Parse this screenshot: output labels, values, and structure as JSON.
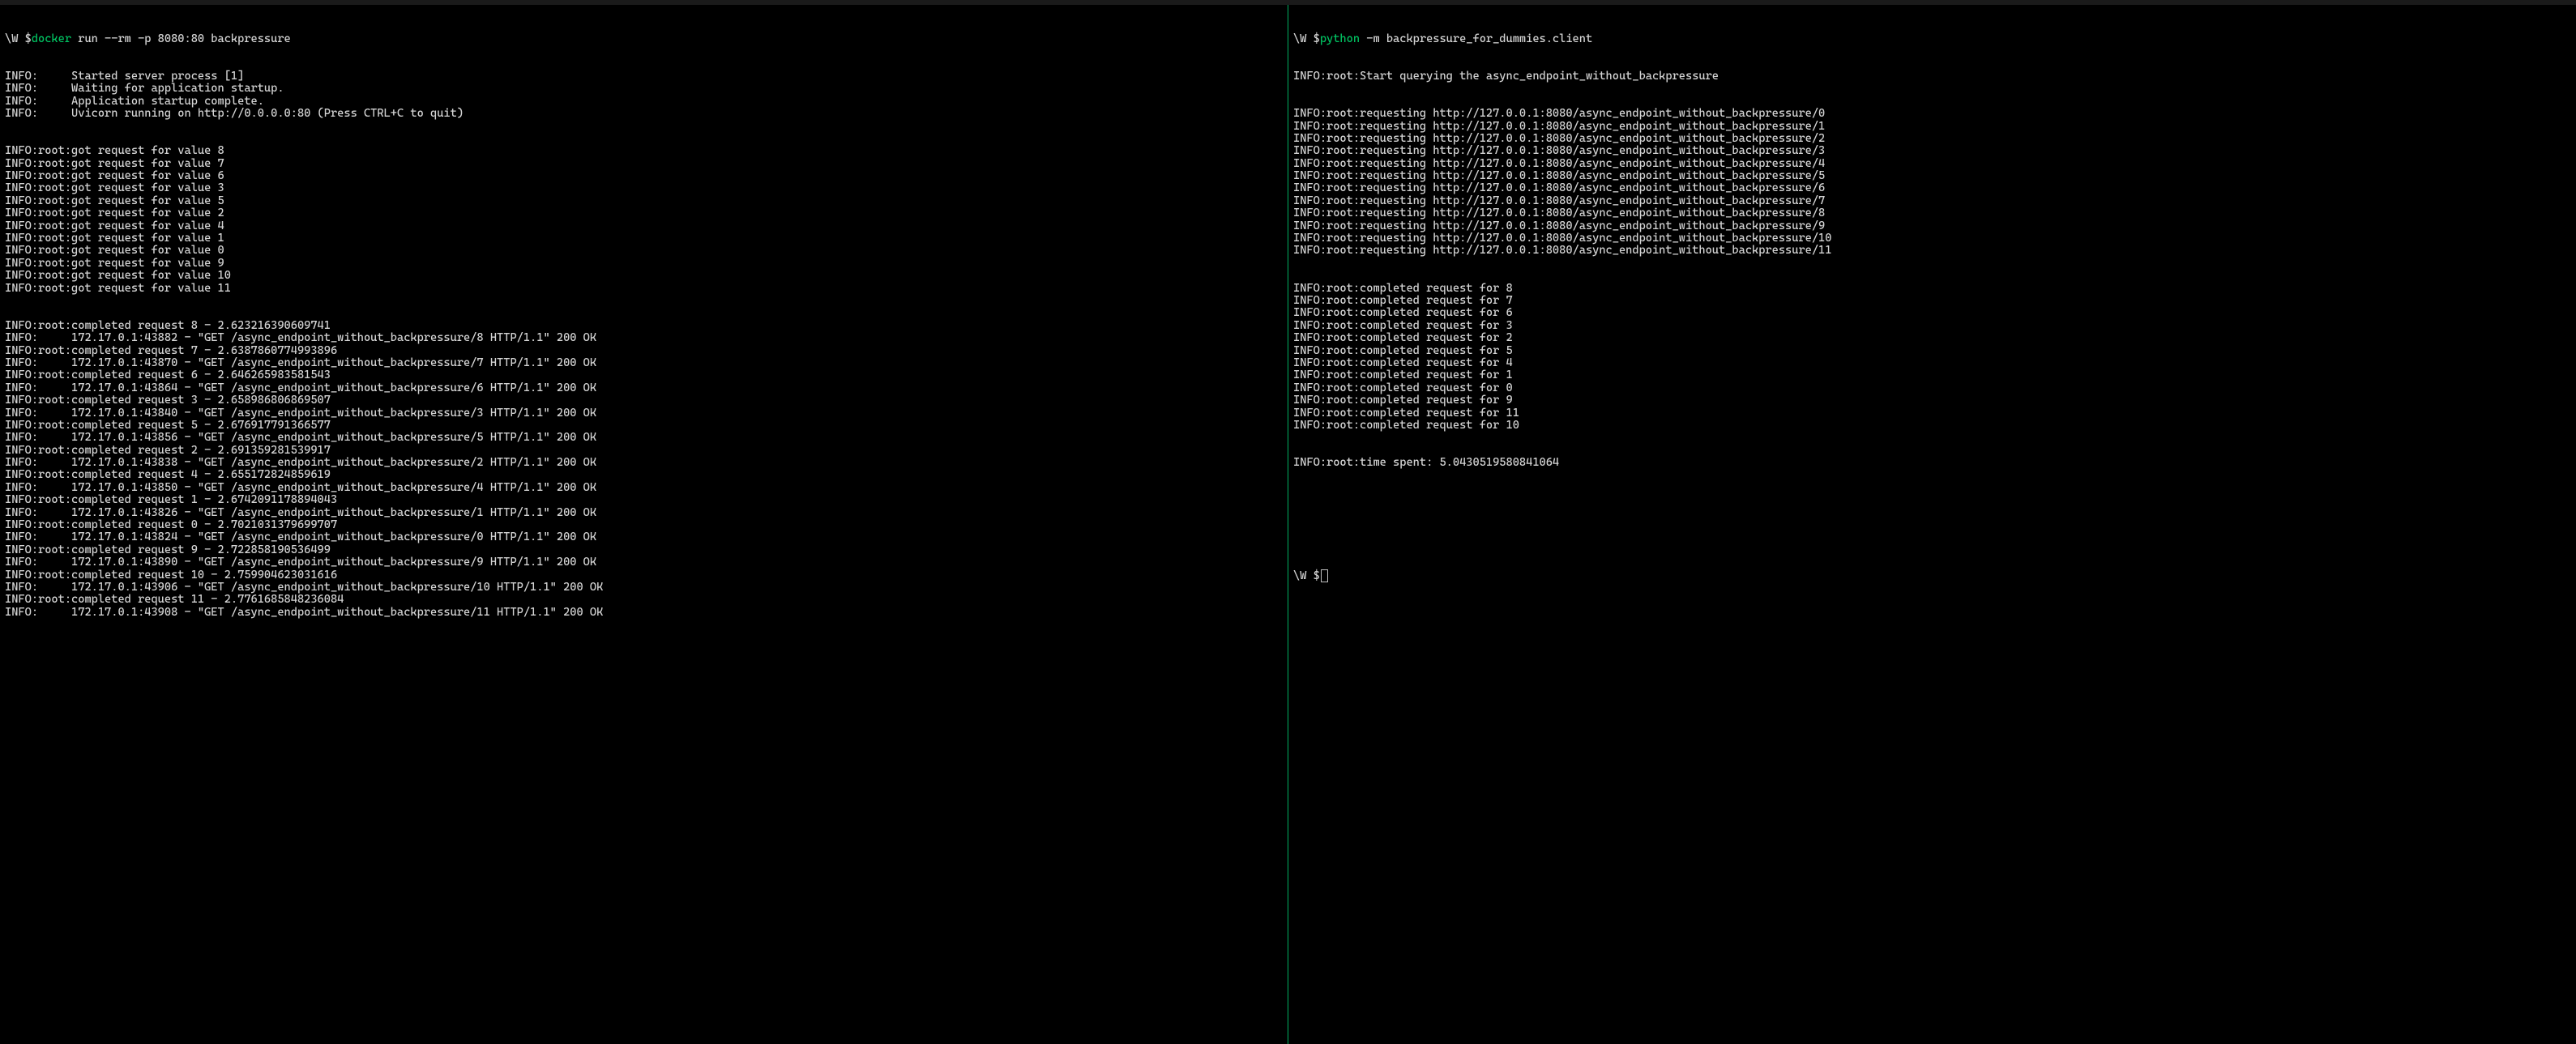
{
  "left": {
    "prompt_prefix": "\\W $",
    "command_bin": "docker",
    "command_args": " run --rm -p 8080:80 backpressure",
    "startup": [
      "INFO:     Started server process [1]",
      "INFO:     Waiting for application startup.",
      "INFO:     Application startup complete.",
      "INFO:     Uvicorn running on http://0.0.0.0:80 (Press CTRL+C to quit)"
    ],
    "got_requests": [
      "INFO:root:got request for value 8",
      "INFO:root:got request for value 7",
      "INFO:root:got request for value 6",
      "INFO:root:got request for value 3",
      "INFO:root:got request for value 5",
      "INFO:root:got request for value 2",
      "INFO:root:got request for value 4",
      "INFO:root:got request for value 1",
      "INFO:root:got request for value 0",
      "INFO:root:got request for value 9",
      "INFO:root:got request for value 10",
      "INFO:root:got request for value 11"
    ],
    "completed_and_access": [
      "INFO:root:completed request 8 - 2.623216390609741",
      "INFO:     172.17.0.1:43882 - \"GET /async_endpoint_without_backpressure/8 HTTP/1.1\" 200 OK",
      "INFO:root:completed request 7 - 2.6387860774993896",
      "INFO:     172.17.0.1:43870 - \"GET /async_endpoint_without_backpressure/7 HTTP/1.1\" 200 OK",
      "INFO:root:completed request 6 - 2.646265983581543",
      "INFO:     172.17.0.1:43864 - \"GET /async_endpoint_without_backpressure/6 HTTP/1.1\" 200 OK",
      "INFO:root:completed request 3 - 2.658986806869507",
      "INFO:     172.17.0.1:43840 - \"GET /async_endpoint_without_backpressure/3 HTTP/1.1\" 200 OK",
      "INFO:root:completed request 5 - 2.676917791366577",
      "INFO:     172.17.0.1:43856 - \"GET /async_endpoint_without_backpressure/5 HTTP/1.1\" 200 OK",
      "INFO:root:completed request 2 - 2.691359281539917",
      "INFO:     172.17.0.1:43838 - \"GET /async_endpoint_without_backpressure/2 HTTP/1.1\" 200 OK",
      "INFO:root:completed request 4 - 2.655172824859619",
      "INFO:     172.17.0.1:43850 - \"GET /async_endpoint_without_backpressure/4 HTTP/1.1\" 200 OK",
      "INFO:root:completed request 1 - 2.6742091178894043",
      "INFO:     172.17.0.1:43826 - \"GET /async_endpoint_without_backpressure/1 HTTP/1.1\" 200 OK",
      "INFO:root:completed request 0 - 2.7021031379699707",
      "INFO:     172.17.0.1:43824 - \"GET /async_endpoint_without_backpressure/0 HTTP/1.1\" 200 OK",
      "INFO:root:completed request 9 - 2.722858190536499",
      "INFO:     172.17.0.1:43890 - \"GET /async_endpoint_without_backpressure/9 HTTP/1.1\" 200 OK",
      "INFO:root:completed request 10 - 2.759904623031616",
      "INFO:     172.17.0.1:43906 - \"GET /async_endpoint_without_backpressure/10 HTTP/1.1\" 200 OK",
      "INFO:root:completed request 11 - 2.7761685848236084",
      "INFO:     172.17.0.1:43908 - \"GET /async_endpoint_without_backpressure/11 HTTP/1.1\" 200 OK"
    ]
  },
  "right": {
    "prompt_prefix": "\\W $",
    "command_bin": "python",
    "command_args": " -m backpressure_for_dummies.client",
    "start_line": "INFO:root:Start querying the async_endpoint_without_backpressure",
    "requesting": [
      "INFO:root:requesting http://127.0.0.1:8080/async_endpoint_without_backpressure/0",
      "INFO:root:requesting http://127.0.0.1:8080/async_endpoint_without_backpressure/1",
      "INFO:root:requesting http://127.0.0.1:8080/async_endpoint_without_backpressure/2",
      "INFO:root:requesting http://127.0.0.1:8080/async_endpoint_without_backpressure/3",
      "INFO:root:requesting http://127.0.0.1:8080/async_endpoint_without_backpressure/4",
      "INFO:root:requesting http://127.0.0.1:8080/async_endpoint_without_backpressure/5",
      "INFO:root:requesting http://127.0.0.1:8080/async_endpoint_without_backpressure/6",
      "INFO:root:requesting http://127.0.0.1:8080/async_endpoint_without_backpressure/7",
      "INFO:root:requesting http://127.0.0.1:8080/async_endpoint_without_backpressure/8",
      "INFO:root:requesting http://127.0.0.1:8080/async_endpoint_without_backpressure/9",
      "INFO:root:requesting http://127.0.0.1:8080/async_endpoint_without_backpressure/10",
      "INFO:root:requesting http://127.0.0.1:8080/async_endpoint_without_backpressure/11"
    ],
    "completed": [
      "INFO:root:completed request for 8",
      "INFO:root:completed request for 7",
      "INFO:root:completed request for 6",
      "INFO:root:completed request for 3",
      "INFO:root:completed request for 2",
      "INFO:root:completed request for 5",
      "INFO:root:completed request for 4",
      "INFO:root:completed request for 1",
      "INFO:root:completed request for 0",
      "INFO:root:completed request for 9",
      "INFO:root:completed request for 11",
      "INFO:root:completed request for 10"
    ],
    "time_spent": "INFO:root:time spent: 5.0430519580841064",
    "idle_prompt_prefix": "\\W $"
  }
}
